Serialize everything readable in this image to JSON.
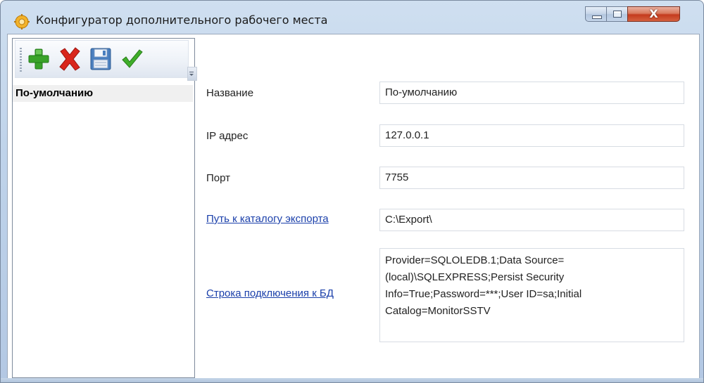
{
  "window": {
    "title": "Конфигуратор дополнительного рабочего места",
    "controls": {
      "minimize": "minimize-icon",
      "maximize": "maximize-icon",
      "close_glyph": "X"
    }
  },
  "toolbar": {
    "buttons": [
      {
        "icon": "plus-icon",
        "color": "#3aa32a"
      },
      {
        "icon": "delete-x-icon",
        "color": "#d9261c"
      },
      {
        "icon": "save-floppy-icon",
        "color": "#4a7fbf"
      },
      {
        "icon": "checkmark-icon",
        "color": "#3fae2a"
      }
    ]
  },
  "sidebar": {
    "items": [
      {
        "label": "По-умолчанию",
        "selected": true
      }
    ]
  },
  "form": {
    "name_label": "Название",
    "name_value": "По-умолчанию",
    "ip_label": "IP адрес",
    "ip_value": "127.0.0.1",
    "port_label": "Порт",
    "port_value": "7755",
    "export_path_label": "Путь к каталогу экспорта",
    "export_path_value": "C:\\Export\\",
    "connection_label": "Строка подключения к БД",
    "connection_value": "Provider=SQLOLEDB.1;Data Source=(local)\\SQLEXPRESS;Persist Security Info=True;Password=***;User ID=sa;Initial Catalog=MonitorSSTV"
  }
}
